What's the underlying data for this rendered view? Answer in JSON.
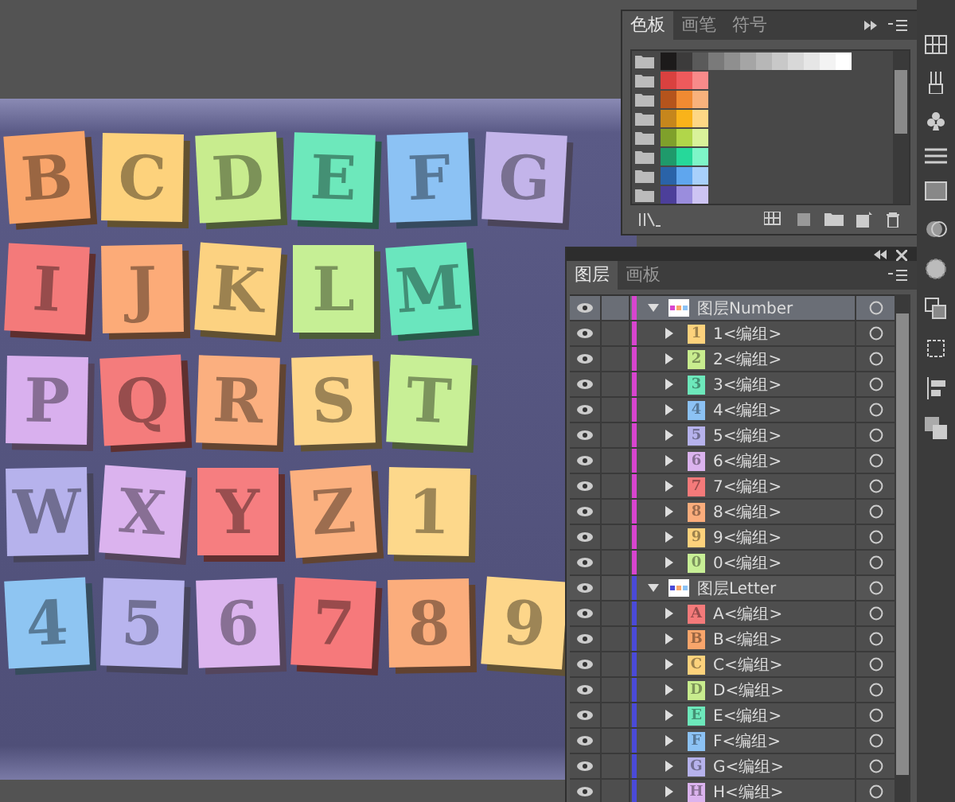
{
  "artboard": {
    "rows": [
      [
        {
          "char": "B",
          "color": "#f9a56b"
        },
        {
          "char": "C",
          "color": "#fdd27c"
        },
        {
          "char": "D",
          "color": "#c8ec8e"
        },
        {
          "char": "E",
          "color": "#6de8bb"
        },
        {
          "char": "F",
          "color": "#8cc2f4"
        },
        {
          "char": "G",
          "color": "#c3b4ea"
        }
      ],
      [
        {
          "char": "I",
          "color": "#f47a7a"
        },
        {
          "char": "J",
          "color": "#fcab78"
        },
        {
          "char": "K",
          "color": "#fcd281"
        },
        {
          "char": "L",
          "color": "#c6ef95"
        },
        {
          "char": "M",
          "color": "#6ae6be"
        }
      ],
      [
        {
          "char": "P",
          "color": "#d9b0ee"
        },
        {
          "char": "Q",
          "color": "#f47c7c"
        },
        {
          "char": "R",
          "color": "#fbaf7f"
        },
        {
          "char": "S",
          "color": "#fdd589"
        },
        {
          "char": "T",
          "color": "#c8ef96"
        }
      ],
      [
        {
          "char": "W",
          "color": "#b6b2ec"
        },
        {
          "char": "X",
          "color": "#dbb3ee"
        },
        {
          "char": "Y",
          "color": "#f67e80"
        },
        {
          "char": "Z",
          "color": "#fbb07f"
        },
        {
          "char": "1",
          "color": "#fdd88b"
        }
      ],
      [
        {
          "char": "4",
          "color": "#8ec5f2"
        },
        {
          "char": "5",
          "color": "#b8b4ee"
        },
        {
          "char": "6",
          "color": "#dcb5ef"
        },
        {
          "char": "7",
          "color": "#f6797b"
        },
        {
          "char": "8",
          "color": "#fbad7c"
        },
        {
          "char": "9",
          "color": "#fdd68a"
        }
      ]
    ]
  },
  "swatches_panel": {
    "tabs": [
      {
        "label": "色板",
        "selected": true
      },
      {
        "label": "画笔",
        "selected": false
      },
      {
        "label": "符号",
        "selected": false
      }
    ],
    "groups": [
      {
        "swatches": [
          {
            "color": "#1c1a1a"
          },
          {
            "color": "#3c3b3b"
          },
          {
            "color": "#5a5a5a"
          },
          {
            "color": "#7a7a7a"
          },
          {
            "color": "#8f8f8f"
          },
          {
            "color": "#a5a5a5"
          },
          {
            "color": "#b7b7b7"
          },
          {
            "color": "#c8c8c8"
          },
          {
            "color": "#d8d8d8"
          },
          {
            "color": "#e6e6e6"
          },
          {
            "color": "#f3f3f3"
          },
          {
            "color": "#ffffff"
          }
        ]
      },
      {
        "swatches": [
          {
            "color": "#d9413f"
          },
          {
            "color": "#ee5a5c"
          },
          {
            "color": "#f88a8a"
          }
        ]
      },
      {
        "swatches": [
          {
            "color": "#b5541c"
          },
          {
            "color": "#f08a32"
          },
          {
            "color": "#f9b27c"
          }
        ]
      },
      {
        "swatches": [
          {
            "color": "#c6861c"
          },
          {
            "color": "#f9b31a"
          },
          {
            "color": "#fdd785"
          }
        ]
      },
      {
        "swatches": [
          {
            "color": "#7fa02b"
          },
          {
            "color": "#b1d64a"
          },
          {
            "color": "#d9f29a"
          }
        ]
      },
      {
        "swatches": [
          {
            "color": "#1f9a6b"
          },
          {
            "color": "#26d89a"
          },
          {
            "color": "#7ef5c8"
          }
        ]
      },
      {
        "swatches": [
          {
            "color": "#2a63a8"
          },
          {
            "color": "#5fa6ee"
          },
          {
            "color": "#a8d0fb"
          }
        ]
      },
      {
        "swatches": [
          {
            "color": "#4c3f9a"
          },
          {
            "color": "#9a8ddd"
          },
          {
            "color": "#cdc4f3"
          }
        ]
      }
    ]
  },
  "layers_panel": {
    "tabs": [
      {
        "label": "图层",
        "selected": true
      },
      {
        "label": "画板",
        "selected": false
      }
    ],
    "layers": [
      {
        "name": "图层Number",
        "color": "#d845cf",
        "expanded": true,
        "selected": true,
        "visible": true,
        "children": [
          {
            "name": "1<编组>",
            "thumb": "1",
            "color": "#fdd27c",
            "visible": true
          },
          {
            "name": "2<编组>",
            "thumb": "2",
            "color": "#c8ec8e",
            "visible": true
          },
          {
            "name": "3<编组>",
            "thumb": "3",
            "color": "#6de8bb",
            "visible": true
          },
          {
            "name": "4<编组>",
            "thumb": "4",
            "color": "#8cc2f4",
            "visible": true
          },
          {
            "name": "5<编组>",
            "thumb": "5",
            "color": "#b6b2ec",
            "visible": true
          },
          {
            "name": "6<编组>",
            "thumb": "6",
            "color": "#dbb3ee",
            "visible": true
          },
          {
            "name": "7<编组>",
            "thumb": "7",
            "color": "#f47a7a",
            "visible": true
          },
          {
            "name": "8<编组>",
            "thumb": "8",
            "color": "#fbad7c",
            "visible": true
          },
          {
            "name": "9<编组>",
            "thumb": "9",
            "color": "#fdd27c",
            "visible": true
          },
          {
            "name": "0<编组>",
            "thumb": "0",
            "color": "#c8ef96",
            "visible": true
          }
        ]
      },
      {
        "name": "图层Letter",
        "color": "#4a4ad8",
        "expanded": true,
        "selected": false,
        "visible": true,
        "children": [
          {
            "name": "A<编组>",
            "thumb": "A",
            "color": "#f47a7a",
            "visible": true
          },
          {
            "name": "B<编组>",
            "thumb": "B",
            "color": "#f9a56b",
            "visible": true
          },
          {
            "name": "C<编组>",
            "thumb": "C",
            "color": "#fdd27c",
            "visible": true
          },
          {
            "name": "D<编组>",
            "thumb": "D",
            "color": "#c8ec8e",
            "visible": true
          },
          {
            "name": "E<编组>",
            "thumb": "E",
            "color": "#6de8bb",
            "visible": true
          },
          {
            "name": "F<编组>",
            "thumb": "F",
            "color": "#8cc2f4",
            "visible": true
          },
          {
            "name": "G<编组>",
            "thumb": "G",
            "color": "#b6b2ec",
            "visible": true
          },
          {
            "name": "H<编组>",
            "thumb": "H",
            "color": "#dbb3ee",
            "visible": true
          }
        ]
      }
    ]
  }
}
